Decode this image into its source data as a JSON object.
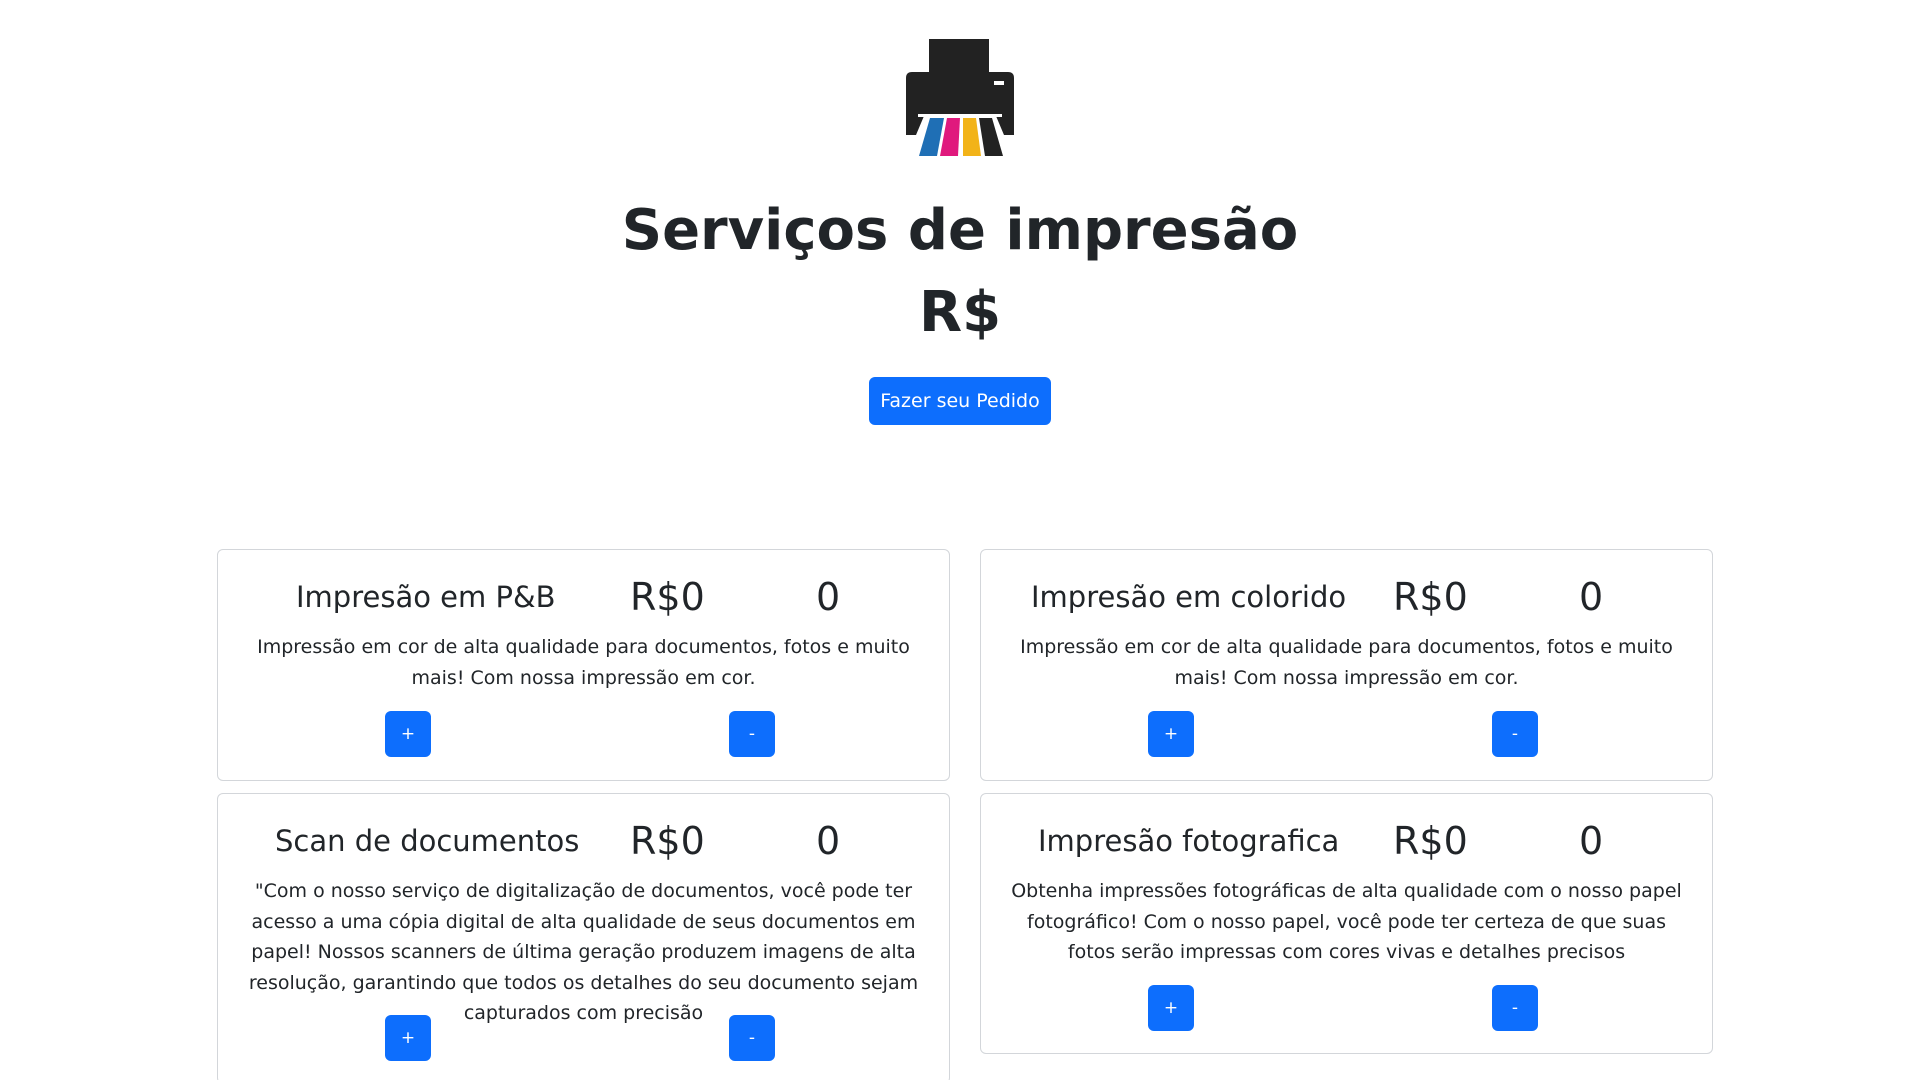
{
  "header": {
    "logo_icon": "color-printer-icon",
    "title": "Serviços de impresão",
    "total": "R$",
    "order_button": "Fazer seu Pedido"
  },
  "cards": [
    {
      "name": "Impresão em P&B",
      "price": "R$0",
      "quantity": "0",
      "description": "Impressão em cor de alta qualidade para documentos, fotos e muito mais! Com nossa impressão em cor.",
      "plus": "+",
      "minus": "-"
    },
    {
      "name": "Impresão em colorido",
      "price": "R$0",
      "quantity": "0",
      "description": "Impressão em cor de alta qualidade para documentos, fotos e muito mais! Com nossa impressão em cor.",
      "plus": "+",
      "minus": "-"
    },
    {
      "name": "Scan de documentos",
      "price": "R$0",
      "quantity": "0",
      "description": "\"Com o nosso serviço de digitalização de documentos, você pode ter acesso a uma cópia digital de alta qualidade de seus documentos em papel! Nossos scanners de última geração produzem imagens de alta resolução, garantindo que todos os detalhes do seu documento sejam capturados com precisão",
      "plus": "+",
      "minus": "-"
    },
    {
      "name": "Impresão fotografica",
      "price": "R$0",
      "quantity": "0",
      "description": "Obtenha impressões fotográficas de alta qualidade com o nosso papel fotográfico! Com o nosso papel, você pode ter certeza de que suas fotos serão impressas com cores vivas e detalhes precisos",
      "plus": "+",
      "minus": "-"
    }
  ],
  "colors": {
    "primary": "#0d6efd",
    "text": "#212529",
    "card_border": "#d3d6da",
    "cyan": "#1f6fb5",
    "magenta": "#e0197d",
    "yellow": "#f2b318"
  }
}
